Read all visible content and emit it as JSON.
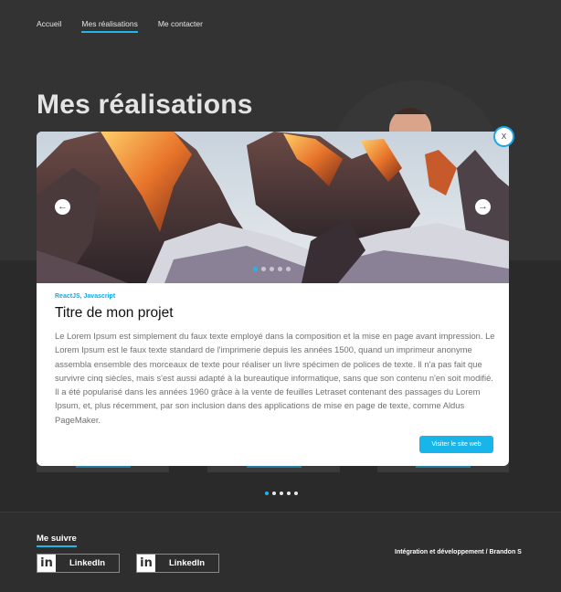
{
  "nav": {
    "items": [
      {
        "label": "Accueil",
        "active": false
      },
      {
        "label": "Mes réalisations",
        "active": true
      },
      {
        "label": "Me contacter",
        "active": false
      }
    ]
  },
  "page_title": "Mes réalisations",
  "modal": {
    "close_label": "X",
    "hero": {
      "prev_icon": "arrow-left-icon",
      "next_icon": "arrow-right-icon",
      "dots_total": 5,
      "dots_active": 0
    },
    "tags": "ReactJS, Javascript",
    "title": "Titre de mon projet",
    "description": "Le Lorem Ipsum est simplement du faux texte employé dans la composition et la mise en page avant impression. Le Lorem Ipsum est le faux texte standard de l'imprimerie depuis les années 1500, quand un imprimeur anonyme assembla ensemble des morceaux de texte pour réaliser un livre spécimen de polices de texte. Il n'a pas fait que survivre cinq siècles, mais s'est aussi adapté à la bureautique informatique, sans que son contenu n'en soit modifié. Il a été popularisé dans les années 1960 grâce à la vente de feuilles Letraset contenant des passages du Lorem Ipsum, et, plus récemment, par son inclusion dans des applications de mise en page de texte, comme Aldus PageMaker.",
    "visit_button": "Visiter le site web"
  },
  "carousel": {
    "dots_total": 5,
    "dots_active": 0
  },
  "footer": {
    "follow_label": "Me suivre",
    "links": [
      {
        "icon": "linkedin-icon",
        "logo_text": "in",
        "label": "LinkedIn"
      },
      {
        "icon": "linkedin-icon",
        "logo_text": "in",
        "label": "LinkedIn"
      }
    ],
    "credit": "Intégration et développement / Brandon S"
  },
  "colors": {
    "accent": "#1fb6e8",
    "background": "#323232",
    "card": "#ffffff"
  }
}
